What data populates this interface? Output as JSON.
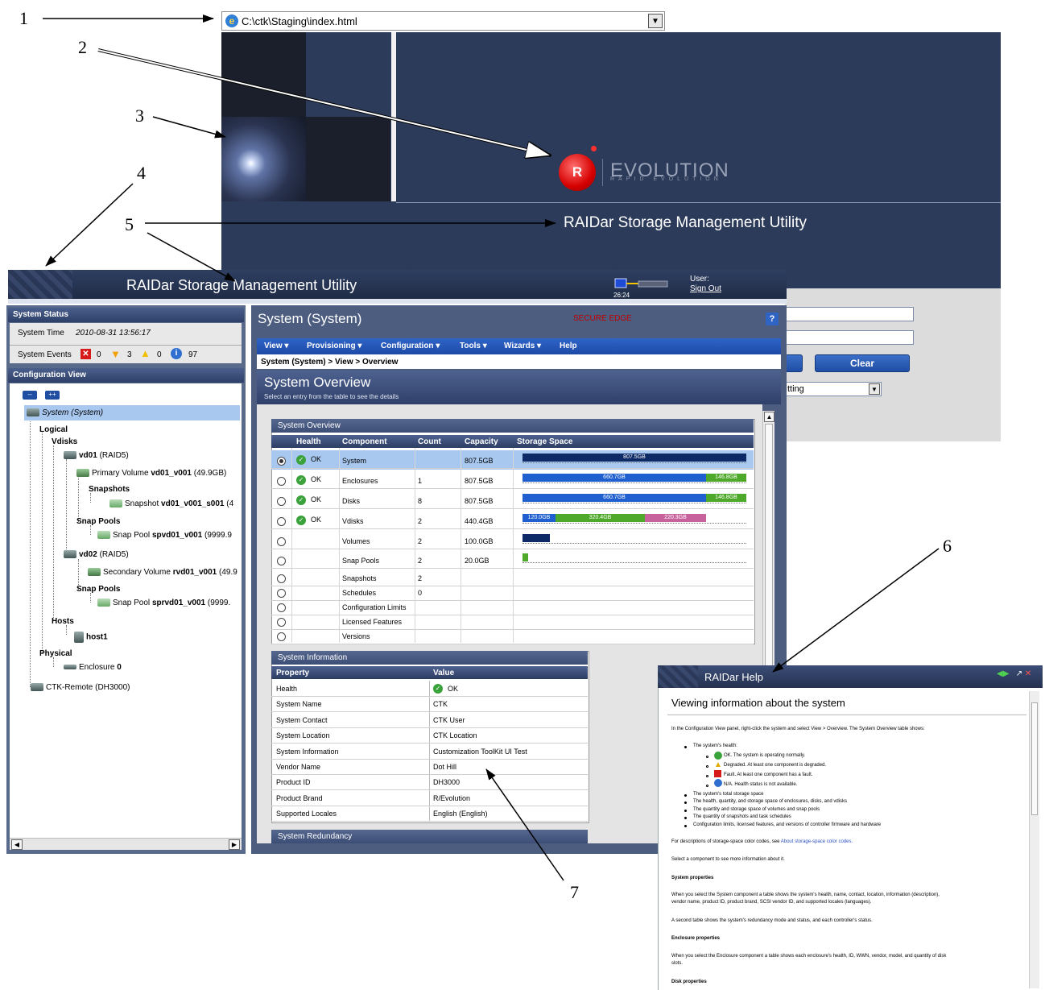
{
  "callouts": [
    "1",
    "2",
    "3",
    "4",
    "5",
    "6",
    "7"
  ],
  "browser": {
    "address": "C:\\ctk\\Staging\\index.html"
  },
  "login": {
    "banner_title": "RAIDar Storage Management Utility",
    "logo_word": "EVOLUTION",
    "logo_sub": "RAPID EVOLUTION",
    "logo_mark": "R",
    "clear_button": "Clear",
    "select_value": "tting"
  },
  "app": {
    "title": "RAIDar Storage Management Utility",
    "conn_time": "26:24",
    "user_label": "User:",
    "sign_out": "Sign Out"
  },
  "status": {
    "header": "System Status",
    "time_label": "System Time",
    "time_value": "2010-08-31 13:56:17",
    "events_label": "System Events",
    "fault_count": "0",
    "warning_count": "3",
    "caution_count": "0",
    "info_count": "97"
  },
  "config": {
    "header": "Configuration View",
    "collapse": "--",
    "expand": "++",
    "tree": {
      "system": "System (System)",
      "logical": "Logical",
      "vdisks": "Vdisks",
      "vd01_name": "vd01",
      "vd01_raid": "(RAID5)",
      "pv_label": "Primary Volume",
      "pv_name": "vd01_v001",
      "pv_size": "(49.9GB)",
      "snapshots": "Snapshots",
      "snap_label": "Snapshot",
      "snap_name": "vd01_v001_s001",
      "snap_tail": "(4",
      "snap_pools_1": "Snap Pools",
      "sp1_label": "Snap Pool",
      "sp1_name": "spvd01_v001",
      "sp1_size": "(9999.9",
      "vd02_name": "vd02",
      "vd02_raid": "(RAID5)",
      "sv_label": "Secondary Volume",
      "sv_name": "rvd01_v001",
      "sv_size": "(49.9",
      "snap_pools_2": "Snap Pools",
      "sp2_label": "Snap Pool",
      "sp2_name": "sprvd01_v001",
      "sp2_size": "(9999.",
      "hosts": "Hosts",
      "host1": "host1",
      "physical": "Physical",
      "enclosure_label": "Enclosure",
      "enclosure_num": "0",
      "remote": "CTK-Remote (DH3000)"
    }
  },
  "main": {
    "title": "System (System)",
    "status_text": "SECURE EDGE",
    "help": "?",
    "menu": [
      "View ▾",
      "Provisioning ▾",
      "Configuration ▾",
      "Tools ▾",
      "Wizards ▾",
      "Help"
    ],
    "breadcrumb": "System (System) > View > Overview",
    "overview_title": "System Overview",
    "overview_sub": "Select an entry from the table to see the details"
  },
  "overview_table": {
    "caption": "System Overview",
    "headers": [
      "Health",
      "Component",
      "Count",
      "Capacity",
      "Storage Space"
    ],
    "rows": [
      {
        "health": "OK",
        "component": "System",
        "count": "",
        "capacity": "807.5GB",
        "bars": [
          "807.5GB"
        ]
      },
      {
        "health": "OK",
        "component": "Enclosures",
        "count": "1",
        "capacity": "807.5GB",
        "bars": [
          "660.7GB",
          "146.8GB"
        ]
      },
      {
        "health": "OK",
        "component": "Disks",
        "count": "8",
        "capacity": "807.5GB",
        "bars": [
          "660.7GB",
          "146.8GB"
        ]
      },
      {
        "health": "OK",
        "component": "Vdisks",
        "count": "2",
        "capacity": "440.4GB",
        "bars": [
          "120.0GB",
          "320.4GB",
          "220.3GB"
        ]
      },
      {
        "health": "",
        "component": "Volumes",
        "count": "2",
        "capacity": "100.0GB",
        "bars": []
      },
      {
        "health": "",
        "component": "Snap Pools",
        "count": "2",
        "capacity": "20.0GB",
        "bars": []
      },
      {
        "health": "",
        "component": "Snapshots",
        "count": "2",
        "capacity": "",
        "bars": []
      },
      {
        "health": "",
        "component": "Schedules",
        "count": "0",
        "capacity": "",
        "bars": []
      },
      {
        "health": "",
        "component": "Configuration Limits",
        "count": "",
        "capacity": "",
        "bars": []
      },
      {
        "health": "",
        "component": "Licensed Features",
        "count": "",
        "capacity": "",
        "bars": []
      },
      {
        "health": "",
        "component": "Versions",
        "count": "",
        "capacity": "",
        "bars": []
      }
    ],
    "colors": {
      "dark": "#0e2a66",
      "blue": "#1f5fd0",
      "green": "#4ea82a",
      "pink": "#c8629c"
    }
  },
  "system_info": {
    "caption": "System Information",
    "headers": [
      "Property",
      "Value"
    ],
    "rows": [
      {
        "property": "Health",
        "value": "OK"
      },
      {
        "property": "System Name",
        "value": "CTK"
      },
      {
        "property": "System Contact",
        "value": "CTK User"
      },
      {
        "property": "System Location",
        "value": "CTK Location"
      },
      {
        "property": "System Information",
        "value": "Customization ToolKit UI Test"
      },
      {
        "property": "Vendor Name",
        "value": "Dot Hill"
      },
      {
        "property": "Product ID",
        "value": "DH3000"
      },
      {
        "property": "Product Brand",
        "value": "R/Evolution"
      },
      {
        "property": "Supported Locales",
        "value": "English (English)"
      }
    ],
    "redundancy_caption": "System Redundancy"
  },
  "help": {
    "window_title": "RAIDar Help",
    "heading": "Viewing information about the system",
    "intro": "In the Configuration View panel, right-click the system and select View > Overview. The System Overview table shows:",
    "health_item": "The system's health:",
    "health_subs": [
      "OK. The system is operating normally.",
      "Degraded. At least one component is degraded.",
      "Fault. At least one component has a fault.",
      "N/A. Health status is not available."
    ],
    "bullets": [
      "The system's total storage space",
      "The health, quantity, and storage space of enclosures, disks, and vdisks",
      "The quantity and storage space of volumes and snap pools",
      "The quantity of snapshots and task schedules",
      "Configuration limits, licensed features, and versions of controller firmware and hardware"
    ],
    "color_codes_text": "For descriptions of storage-space color codes, see",
    "color_codes_link": "About storage-space color codes.",
    "select_text": "Select a component to see more information about it.",
    "sys_props_head": "System properties",
    "sys_props_p1": "When you select the System component a table shows the system's health, name, contact, location, information (description),",
    "sys_props_p2": "vendor name, product ID, product brand, SCSI vendor ID, and supported locales (languages).",
    "sys_props_p3": "A second table shows the system's redundancy mode and status, and each controller's status.",
    "encl_head": "Enclosure properties",
    "encl_p1": "When you select the Enclosure component a table shows each enclosure's health, ID, WWN, vendor, model, and quantity of disk",
    "encl_p2": "slots.",
    "disk_head": "Disk properties"
  }
}
